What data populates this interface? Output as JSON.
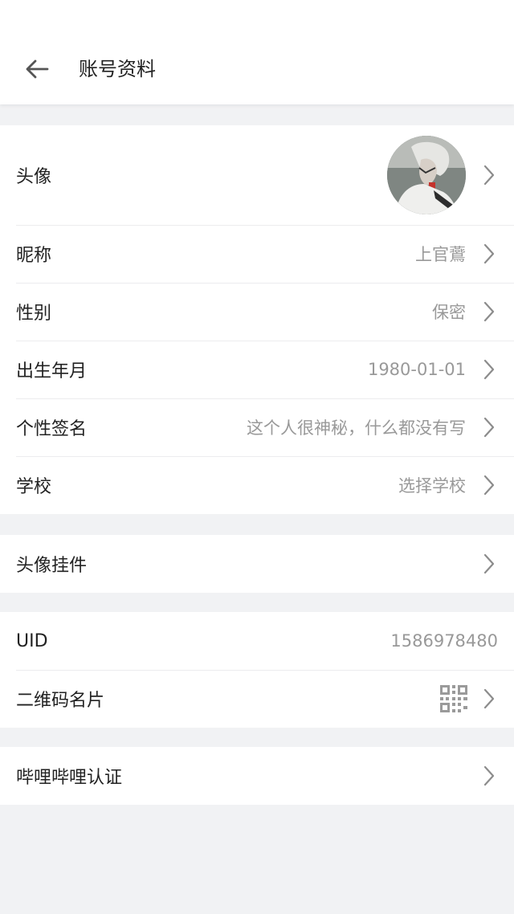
{
  "header": {
    "title": "账号资料"
  },
  "profile": {
    "avatar_label": "头像",
    "nickname_label": "昵称",
    "nickname": "上官鷰",
    "gender_label": "性别",
    "gender": "保密",
    "birthday_label": "出生年月",
    "birthday": "1980-01-01",
    "signature_label": "个性签名",
    "signature": "这个人很神秘，什么都没有写",
    "school_label": "学校",
    "school": "选择学校"
  },
  "pendant": {
    "label": "头像挂件"
  },
  "account": {
    "uid_label": "UID",
    "uid": "1586978480",
    "qr_label": "二维码名片"
  },
  "verify": {
    "label": "哔哩哔哩认证"
  },
  "icons": {
    "back": "arrow-left-icon",
    "chevron": "chevron-right-icon",
    "qr": "qr-code-icon"
  },
  "colors": {
    "background": "#f1f2f4",
    "value_text": "#999999",
    "chevron": "#8c8c8c"
  }
}
